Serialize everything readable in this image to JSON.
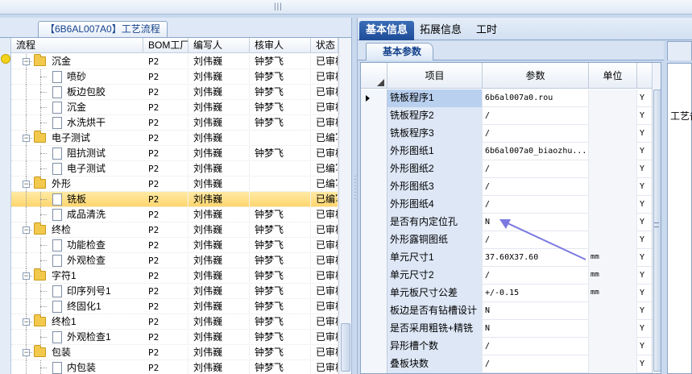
{
  "window": {
    "grip": "|||"
  },
  "left_panel": {
    "tab_title": "【6B6AL007A0】工艺流程",
    "columns": [
      "流程",
      "BOM工厂",
      "编写人",
      "核审人",
      "状态"
    ],
    "rows": [
      {
        "label": "沉金",
        "type": "folder",
        "bom": "P2",
        "writer": "刘伟巍",
        "checker": "钟梦飞",
        "status": "已审核"
      },
      {
        "label": "喷砂",
        "type": "doc",
        "bom": "P2",
        "writer": "刘伟巍",
        "checker": "钟梦飞",
        "status": "已审核"
      },
      {
        "label": "板边包胶",
        "type": "doc",
        "bom": "P2",
        "writer": "刘伟巍",
        "checker": "钟梦飞",
        "status": "已审核"
      },
      {
        "label": "沉金",
        "type": "doc",
        "bom": "P2",
        "writer": "刘伟巍",
        "checker": "钟梦飞",
        "status": "已审核"
      },
      {
        "label": "水洗烘干",
        "type": "doc",
        "bom": "P2",
        "writer": "刘伟巍",
        "checker": "钟梦飞",
        "status": "已审核"
      },
      {
        "label": "电子测试",
        "type": "folder",
        "bom": "P2",
        "writer": "刘伟巍",
        "checker": "",
        "status": "已编写"
      },
      {
        "label": "阻抗测试",
        "type": "doc",
        "bom": "P2",
        "writer": "刘伟巍",
        "checker": "钟梦飞",
        "status": "已审核"
      },
      {
        "label": "电子测试",
        "type": "doc",
        "bom": "P2",
        "writer": "刘伟巍",
        "checker": "",
        "status": "已编写"
      },
      {
        "label": "外形",
        "type": "folder",
        "bom": "P2",
        "writer": "刘伟巍",
        "checker": "",
        "status": "已编写"
      },
      {
        "label": "铣板",
        "type": "doc",
        "bom": "P2",
        "writer": "刘伟巍",
        "checker": "",
        "status": "已编写",
        "selected": true
      },
      {
        "label": "成品清洗",
        "type": "doc",
        "bom": "P2",
        "writer": "刘伟巍",
        "checker": "钟梦飞",
        "status": "已审核"
      },
      {
        "label": "终检",
        "type": "folder",
        "bom": "P2",
        "writer": "刘伟巍",
        "checker": "钟梦飞",
        "status": "已审核"
      },
      {
        "label": "功能检查",
        "type": "doc",
        "bom": "P2",
        "writer": "刘伟巍",
        "checker": "钟梦飞",
        "status": "已审核"
      },
      {
        "label": "外观检查",
        "type": "doc",
        "bom": "P2",
        "writer": "刘伟巍",
        "checker": "钟梦飞",
        "status": "已审核"
      },
      {
        "label": "字符1",
        "type": "folder",
        "bom": "P2",
        "writer": "刘伟巍",
        "checker": "钟梦飞",
        "status": "已审核"
      },
      {
        "label": "印序列号1",
        "type": "doc",
        "bom": "P2",
        "writer": "刘伟巍",
        "checker": "钟梦飞",
        "status": "已审核"
      },
      {
        "label": "终固化1",
        "type": "doc",
        "bom": "P2",
        "writer": "刘伟巍",
        "checker": "钟梦飞",
        "status": "已审核"
      },
      {
        "label": "终检1",
        "type": "folder",
        "bom": "P2",
        "writer": "刘伟巍",
        "checker": "钟梦飞",
        "status": "已审核"
      },
      {
        "label": "外观检查1",
        "type": "doc",
        "bom": "P2",
        "writer": "刘伟巍",
        "checker": "钟梦飞",
        "status": "已审核"
      },
      {
        "label": "包装",
        "type": "folder",
        "bom": "P2",
        "writer": "刘伟巍",
        "checker": "钟梦飞",
        "status": "已审核"
      },
      {
        "label": "内包装",
        "type": "doc",
        "bom": "P2",
        "writer": "刘伟巍",
        "checker": "钟梦飞",
        "status": "已审核"
      }
    ]
  },
  "right_panel": {
    "tabs": [
      "基本信息",
      "拓展信息",
      "工时"
    ],
    "active_tab": "基本信息",
    "sub_tab": "基本参数",
    "side_label": "工艺备",
    "columns": [
      "项目",
      "参数",
      "单位"
    ],
    "rows": [
      {
        "item": "铣板程序1",
        "param": "6b6al007a0.rou",
        "unit": "",
        "flag": "Y"
      },
      {
        "item": "铣板程序2",
        "param": "/",
        "unit": "",
        "flag": "Y"
      },
      {
        "item": "铣板程序3",
        "param": "/",
        "unit": "",
        "flag": "Y"
      },
      {
        "item": "外形图纸1",
        "param": "6b6al007a0_biaozhu...",
        "unit": "",
        "flag": "Y"
      },
      {
        "item": "外形图纸2",
        "param": "/",
        "unit": "",
        "flag": "Y"
      },
      {
        "item": "外形图纸3",
        "param": "/",
        "unit": "",
        "flag": "Y"
      },
      {
        "item": "外形图纸4",
        "param": "/",
        "unit": "",
        "flag": "Y"
      },
      {
        "item": "是否有内定位孔",
        "param": "N",
        "unit": "",
        "flag": "Y"
      },
      {
        "item": "外形露铜图纸",
        "param": "/",
        "unit": "",
        "flag": "Y"
      },
      {
        "item": "单元尺寸1",
        "param": "37.60X37.60",
        "unit": "mm",
        "flag": "Y"
      },
      {
        "item": "单元尺寸2",
        "param": "/",
        "unit": "mm",
        "flag": "Y"
      },
      {
        "item": "单元板尺寸公差",
        "param": "+/-0.15",
        "unit": "mm",
        "flag": "Y"
      },
      {
        "item": "板边是否有钻槽设计",
        "param": "N",
        "unit": "",
        "flag": "Y"
      },
      {
        "item": "是否采用粗铣+精铣",
        "param": "N",
        "unit": "",
        "flag": "Y"
      },
      {
        "item": "异形槽个数",
        "param": "/",
        "unit": "",
        "flag": "Y"
      },
      {
        "item": "叠板块数",
        "param": "/",
        "unit": "",
        "flag": "Y"
      }
    ]
  },
  "colors": {
    "accent": "#1d4c97",
    "selection": "#ffd66e",
    "annotation_arrow": "#7b79e0"
  }
}
